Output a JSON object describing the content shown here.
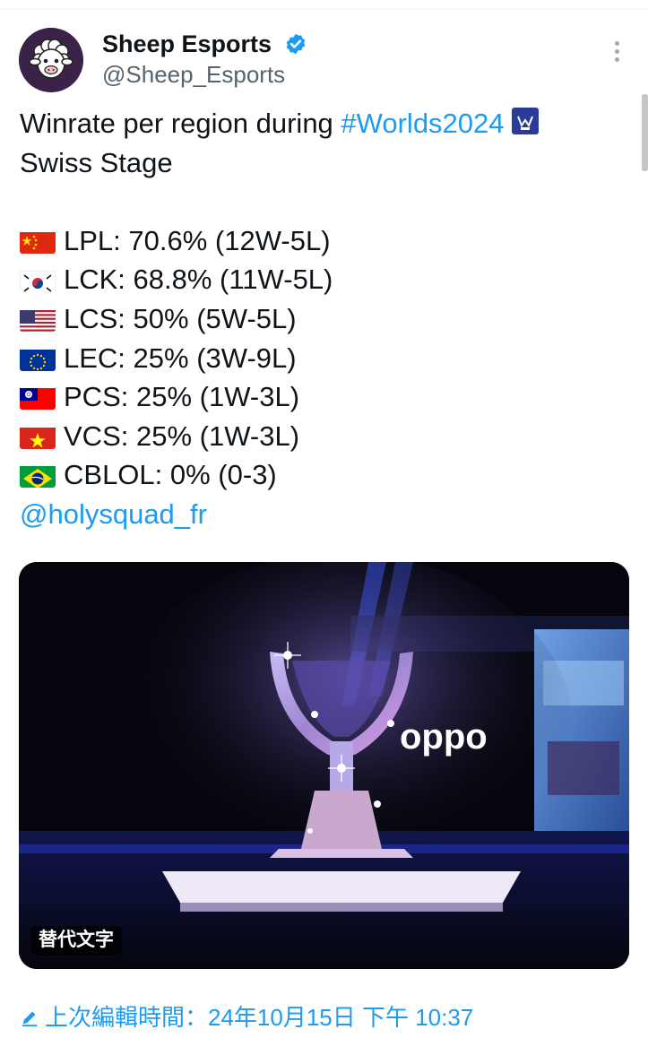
{
  "colors": {
    "link_blue": "#1d9bf0",
    "verified_blue": "#1d9bf0",
    "secondary_text": "#536471",
    "avatar_bg": "#3b2249"
  },
  "author": {
    "display_name": "Sheep Esports",
    "handle": "@Sheep_Esports",
    "verified": true,
    "avatar_icon": "sheep-logo-icon"
  },
  "tweet": {
    "intro_text": "Winrate per region during ",
    "hashtag": "#Worlds2024",
    "hashtag_emoji": "worlds-trophy-emoji",
    "second_line": "Swiss Stage",
    "stats": [
      {
        "flag": "china-flag-icon",
        "text": "LPL: 70.6% (12W-5L)"
      },
      {
        "flag": "south-korea-flag-icon",
        "text": "LCK: 68.8% (11W-5L)"
      },
      {
        "flag": "usa-flag-icon",
        "text": "LCS: 50% (5W-5L)"
      },
      {
        "flag": "eu-flag-icon",
        "text": "LEC: 25% (3W-9L)"
      },
      {
        "flag": "taiwan-flag-icon",
        "text": "PCS: 25% (1W-3L)"
      },
      {
        "flag": "vietnam-flag-icon",
        "text": "VCS: 25% (1W-3L)"
      },
      {
        "flag": "brazil-flag-icon",
        "text": "CBLOL: 0% (0-3)"
      }
    ],
    "mention": "@holysquad_fr"
  },
  "media": {
    "image_subject": "worlds-trophy-photo",
    "alt_badge": "替代文字",
    "sign_text": "oppo"
  },
  "footer": {
    "edited_label": "上次編輯時間：24年10月15日 下午 10:37"
  }
}
